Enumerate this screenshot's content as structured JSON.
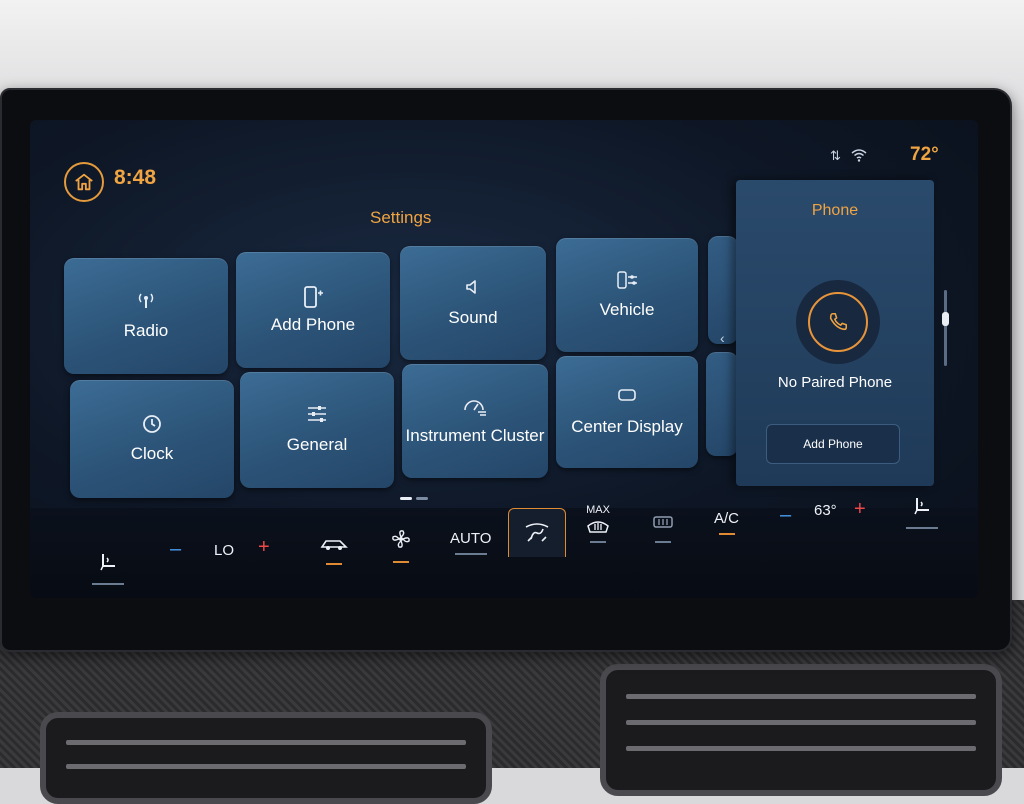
{
  "status": {
    "time": "8:48",
    "outside_temp": "72°"
  },
  "settings": {
    "title": "Settings",
    "tiles": [
      {
        "label": "Radio",
        "icon": "antenna-icon"
      },
      {
        "label": "Add Phone",
        "icon": "add-phone-icon"
      },
      {
        "label": "Sound",
        "icon": "speaker-icon"
      },
      {
        "label": "Vehicle",
        "icon": "vehicle-settings-icon"
      },
      {
        "label": "Clock",
        "icon": "clock-icon"
      },
      {
        "label": "General",
        "icon": "sliders-icon"
      },
      {
        "label": "Instrument Cluster",
        "icon": "gauge-icon"
      },
      {
        "label": "Center Display",
        "icon": "display-icon"
      }
    ]
  },
  "phone_panel": {
    "title": "Phone",
    "status": "No Paired Phone",
    "button": "Add Phone"
  },
  "climate": {
    "driver_temp": "LO",
    "mode": "AUTO",
    "max_defrost": "MAX",
    "ac": "A/C",
    "passenger_temp": "63°",
    "minus": "–",
    "plus": "+"
  },
  "colors": {
    "accent": "#f0a442",
    "tile": "#2c5478",
    "plus": "#f04848",
    "minus": "#4a9ff0"
  }
}
